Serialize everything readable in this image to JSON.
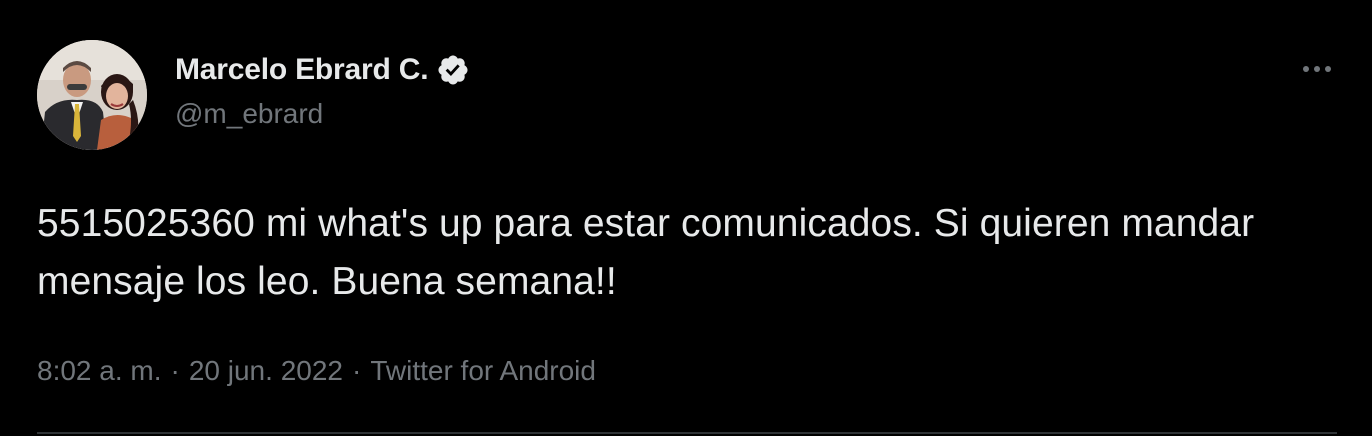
{
  "user": {
    "display_name": "Marcelo Ebrard C.",
    "handle": "@m_ebrard",
    "verified": true
  },
  "tweet": {
    "text": "5515025360 mi what's up para estar comunicados. Si quieren mandar mensaje los leo. Buena semana!!",
    "time": "8:02 a. m.",
    "date": "20 jun. 2022",
    "source": "Twitter for Android",
    "separator": "·"
  },
  "icons": {
    "verified": "verified-badge-icon",
    "more": "more-options-icon"
  },
  "colors": {
    "background": "#000000",
    "primary_text": "#e7e9ea",
    "secondary_text": "#71767b",
    "verified_badge": "#e7e9ea",
    "divider": "#2f3336"
  }
}
